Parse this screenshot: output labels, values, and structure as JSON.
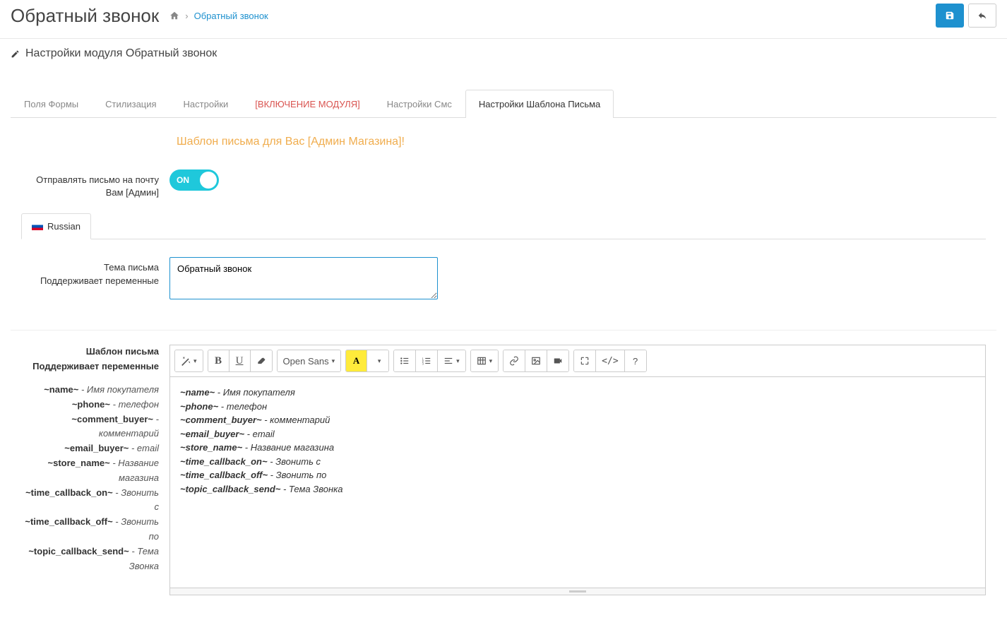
{
  "header": {
    "title": "Обратный звонок",
    "breadcrumb_current": "Обратный звонок"
  },
  "panel": {
    "heading": "Настройки модуля Обратный звонок"
  },
  "tabs": [
    {
      "label": "Поля Формы"
    },
    {
      "label": "Стилизация"
    },
    {
      "label": "Настройки"
    },
    {
      "label": "[ВКЛЮЧЕНИЕ МОДУЛЯ]"
    },
    {
      "label": "Настройки Смс"
    },
    {
      "label": "Настройки Шаблона Письма"
    }
  ],
  "section_title": "Шаблон письма для Вас [Админ Магазина]!",
  "form": {
    "send_admin_label": "Отправлять письмо на почту Вам [Админ]",
    "toggle_on": "ON",
    "language_tab": "Russian",
    "subject_label_line1": "Тема письма",
    "subject_label_line2": "Поддерживает переменные",
    "subject_value": "Обратный звонок",
    "template_label_line1": "Шаблон письма",
    "template_label_line2": "Поддерживает переменные"
  },
  "toolbar": {
    "font_label": "Open Sans"
  },
  "variables": [
    {
      "token": "~name~",
      "desc": "Имя покупателя"
    },
    {
      "token": "~phone~",
      "desc": "телефон"
    },
    {
      "token": "~comment_buyer~",
      "desc": "комментарий"
    },
    {
      "token": "~email_buyer~",
      "desc": "email"
    },
    {
      "token": "~store_name~",
      "desc": "Название магазина"
    },
    {
      "token": "~time_callback_on~",
      "desc": "Звонить с"
    },
    {
      "token": "~time_callback_off~",
      "desc": "Звонить по"
    },
    {
      "token": "~topic_callback_send~",
      "desc": "Тема Звонка"
    }
  ],
  "editor_lines": [
    {
      "token": "~name~",
      "desc": "Имя покупателя"
    },
    {
      "token": "~phone~",
      "desc": "телефон"
    },
    {
      "token": "~comment_buyer~",
      "desc": "комментарий"
    },
    {
      "token": "~email_buyer~",
      "desc": "email"
    },
    {
      "token": "~store_name~",
      "desc": "Название магазина"
    },
    {
      "token": "~time_callback_on~",
      "desc": "Звонить с"
    },
    {
      "token": "~time_callback_off~",
      "desc": "Звонить по"
    },
    {
      "token": "~topic_callback_send~",
      "desc": "Тема Звонка"
    }
  ]
}
